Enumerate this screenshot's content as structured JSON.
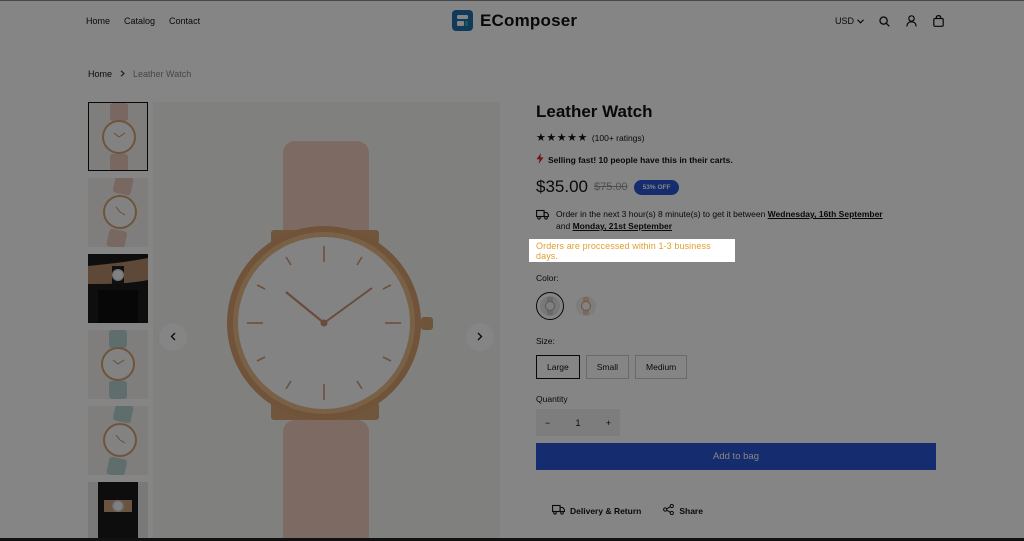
{
  "header": {
    "nav": [
      "Home",
      "Catalog",
      "Contact"
    ],
    "logo_text": "EComposer",
    "currency": "USD",
    "icons": [
      "search-icon",
      "account-icon",
      "bag-icon"
    ]
  },
  "breadcrumb": {
    "home": "Home",
    "current": "Leather Watch"
  },
  "gallery": {
    "thumbnails": [
      "pink-watch-front",
      "pink-watch-angle",
      "watch-on-wrist-dark",
      "mint-watch-front",
      "mint-watch-angle",
      "watch-on-wrist-gray"
    ],
    "active_index": 0,
    "prev_icon": "chevron-left-icon",
    "next_icon": "chevron-right-icon"
  },
  "product": {
    "title": "Leather Watch",
    "rating_text": "(100+ ratings)",
    "stars": 5,
    "selling_text": "Selling fast! 10 people have this in their carts.",
    "price": "$35.00",
    "compare_price": "$75.00",
    "discount_badge": "53% OFF",
    "delivery_prefix": "Order in the next 3 hour(s) 8 minute(s) to get it between",
    "delivery_date_start": "Wednesday, 16th September",
    "delivery_and": "and",
    "delivery_date_end": "Monday, 21st September",
    "processing_note": "Orders are proccessed within 1-3 business days.",
    "color_label": "Color:",
    "size_label": "Size:",
    "sizes": [
      "Large",
      "Small",
      "Medium"
    ],
    "selected_size": "Large",
    "quantity_label": "Quantity",
    "quantity": "1",
    "minus": "−",
    "plus": "+",
    "add_to_bag": "Add to bag",
    "delivery_return": "Delivery & Return",
    "share": "Share"
  },
  "colors": {
    "accent": "#2a55d4",
    "highlight_text": "#e0a030",
    "overlay": "rgba(0,0,0,0.48)"
  }
}
